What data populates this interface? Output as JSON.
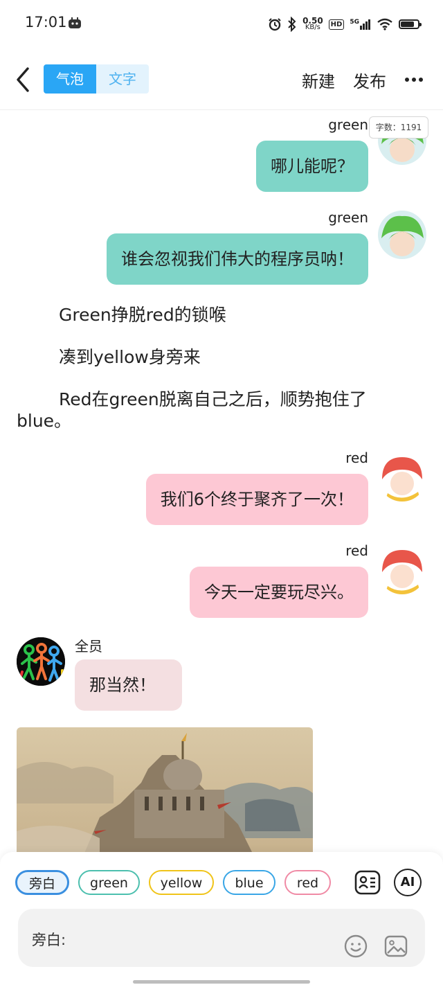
{
  "status_bar": {
    "time": "17:01",
    "net_speed_value": "0.50",
    "net_speed_unit": "KB/s",
    "hd_label": "HD",
    "network_label": "5G",
    "battery_level": 0.8
  },
  "header": {
    "tabs": [
      {
        "label": "气泡",
        "active": true
      },
      {
        "label": "文字",
        "active": false
      }
    ],
    "new_label": "新建",
    "publish_label": "发布"
  },
  "word_count": "字数：1191",
  "messages": [
    {
      "type": "bubble",
      "side": "right",
      "speaker": "green",
      "text": "哪儿能呢？",
      "color": "#7fd5c8"
    },
    {
      "type": "bubble",
      "side": "right",
      "speaker": "green",
      "text": "谁会忽视我们伟大的程序员呐！",
      "color": "#7fd5c8"
    },
    {
      "type": "narration",
      "text": "Green挣脱red的锁喉"
    },
    {
      "type": "narration",
      "text": "凑到yellow身旁来"
    },
    {
      "type": "narration",
      "text_line1": "Red在green脱离自己之后，顺势抱住了",
      "text_line2": "blue。"
    },
    {
      "type": "bubble",
      "side": "right",
      "speaker": "red",
      "text": "我们6个终于聚齐了一次！",
      "color": "#fdc8d4"
    },
    {
      "type": "bubble",
      "side": "right",
      "speaker": "red",
      "text": "今天一定要玩尽兴。",
      "color": "#fdc8d4"
    },
    {
      "type": "bubble",
      "side": "left",
      "speaker": "全员",
      "text": "那当然！",
      "color": "#f4dfe1"
    }
  ],
  "role_chips": [
    {
      "label": "旁白",
      "color": "#3a8fe0",
      "selected": true
    },
    {
      "label": "green",
      "color": "#4cbfae",
      "selected": false
    },
    {
      "label": "yellow",
      "color": "#f0c419",
      "selected": false
    },
    {
      "label": "blue",
      "color": "#39a6e6",
      "selected": false
    },
    {
      "label": "red",
      "color": "#f08aa5",
      "selected": false
    }
  ],
  "tools": {
    "ai_label": "AI",
    "roles_icon": "role-card-icon"
  },
  "input": {
    "label": "旁白:"
  },
  "icons": [
    "back-arrow-icon",
    "more-icon",
    "emoji-icon",
    "image-icon",
    "alarm-icon",
    "bluetooth-icon",
    "wifi-icon",
    "battery-icon"
  ]
}
